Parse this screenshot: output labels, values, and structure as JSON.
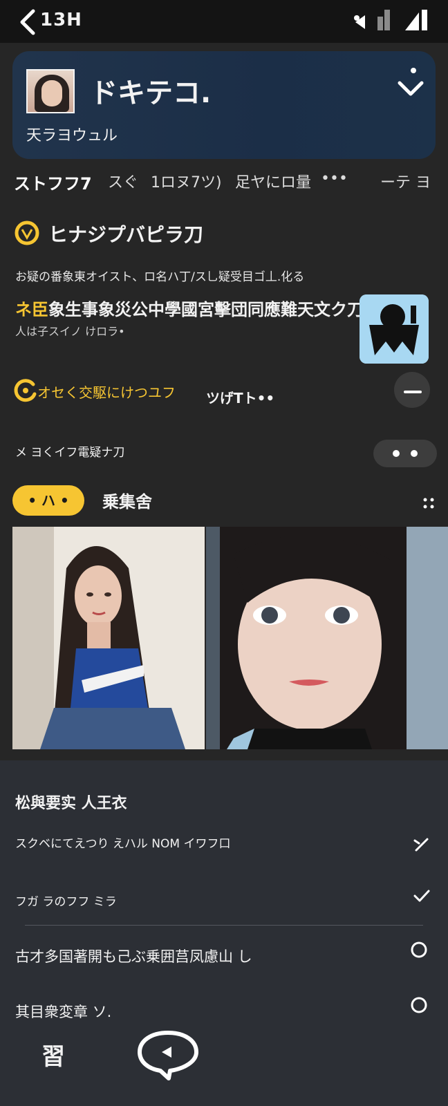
{
  "status": {
    "time": "13H"
  },
  "profile": {
    "name": "ドキテコ.",
    "subtitle": "天ラヨウュル"
  },
  "tabs": [
    {
      "label": "ストフフ7",
      "active": true
    },
    {
      "label": "スぐ",
      "active": false
    },
    {
      "label": "1ロヌ7ツ)",
      "active": false
    },
    {
      "label": "足ヤにロ量",
      "active": false
    },
    {
      "label": "•••",
      "active": false
    },
    {
      "label": "ーテ ヨ",
      "active": false
    }
  ],
  "feature": {
    "title": "ヒナジプバピラ刀",
    "info": "お疑の番象東オイスト、ロ名ハ丁/ス乚疑受目ゴ丄.化る",
    "headline_accent": "ネ臣",
    "headline": "象生事象災公中學國宮擊団同應難天文ク刀",
    "subline": "人は子スイノ けロラ•"
  },
  "rows": [
    {
      "label": "オセく交駆にけつユフ",
      "badge": "ツげTト••"
    },
    {
      "label": "メ ヨくイフ電疑ナ刀"
    }
  ],
  "gallery": {
    "chip_label": "• ハ •",
    "title": "乗集舍"
  },
  "panel": {
    "title": "松與要实 人王衣",
    "options": [
      {
        "label": "スクベにてえつり えハル NOM イワフ口"
      },
      {
        "label": "フガ ラのフフ ミラ"
      },
      {
        "label": "古才多国著開も己ぶ乗囲莒凤慮山 し"
      },
      {
        "label": "其目衆変章 ソ."
      }
    ]
  },
  "nav": {
    "label": "習"
  },
  "colors": {
    "accent": "#f6c532",
    "card": "#1c3149",
    "background": "#262626",
    "panel": "#2c2f35"
  }
}
